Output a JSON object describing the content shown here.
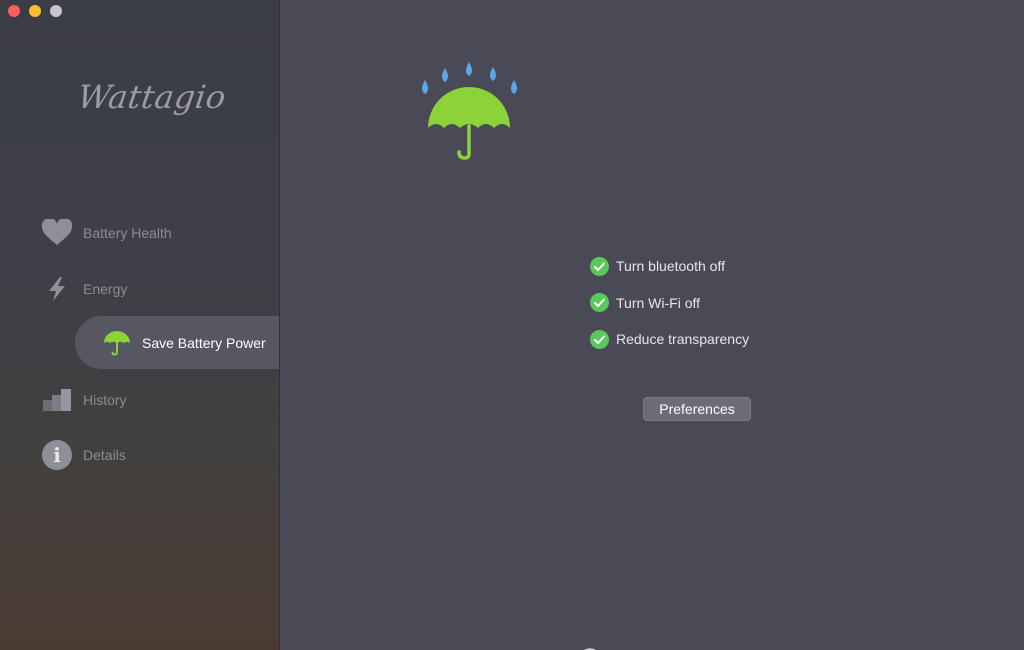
{
  "app": {
    "name": "Wattagio"
  },
  "sidebar": {
    "items": [
      {
        "label": "Battery Health",
        "icon": "heart-icon"
      },
      {
        "label": "Energy",
        "icon": "lightning-icon"
      },
      {
        "label": "Save Battery Power",
        "icon": "umbrella-icon",
        "selected": true
      },
      {
        "label": "History",
        "icon": "bar-chart-icon"
      },
      {
        "label": "Details",
        "icon": "info-icon"
      }
    ]
  },
  "main": {
    "hero_icon": "umbrella-rain-icon",
    "checklist": [
      {
        "label": "Turn bluetooth off",
        "checked": true
      },
      {
        "label": "Turn Wi-Fi off",
        "checked": true
      },
      {
        "label": "Reduce transparency",
        "checked": true
      }
    ],
    "preferences_label": "Preferences"
  },
  "colors": {
    "accent_green": "#8cd33a",
    "check_green": "#5ac85a",
    "rain_blue": "#5aa8e8",
    "sidebar_selected": "#565762",
    "main_bg": "#4a4a56"
  }
}
